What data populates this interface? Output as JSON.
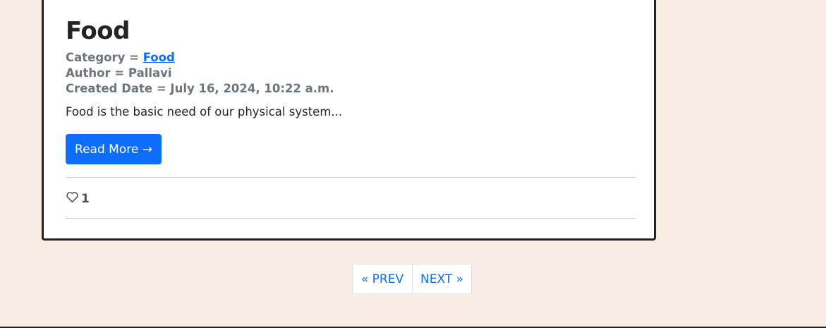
{
  "post": {
    "title": "Food",
    "category_label": "Category = ",
    "category_value": "Food",
    "author_text": "Author = Pallavi",
    "created_text": "Created Date = July 16, 2024, 10:22 a.m.",
    "excerpt": "Food is the basic need of our physical system...",
    "read_more_label": "Read More →",
    "likes_count": "1",
    "like_icon": "heart-outline-icon"
  },
  "pagination": {
    "prev_label": "« PREV",
    "next_label": "NEXT »"
  },
  "colors": {
    "page_background": "#f8ede2",
    "accent": "#0d6efd",
    "card_border": "#222222",
    "muted_text": "#6c757d"
  }
}
